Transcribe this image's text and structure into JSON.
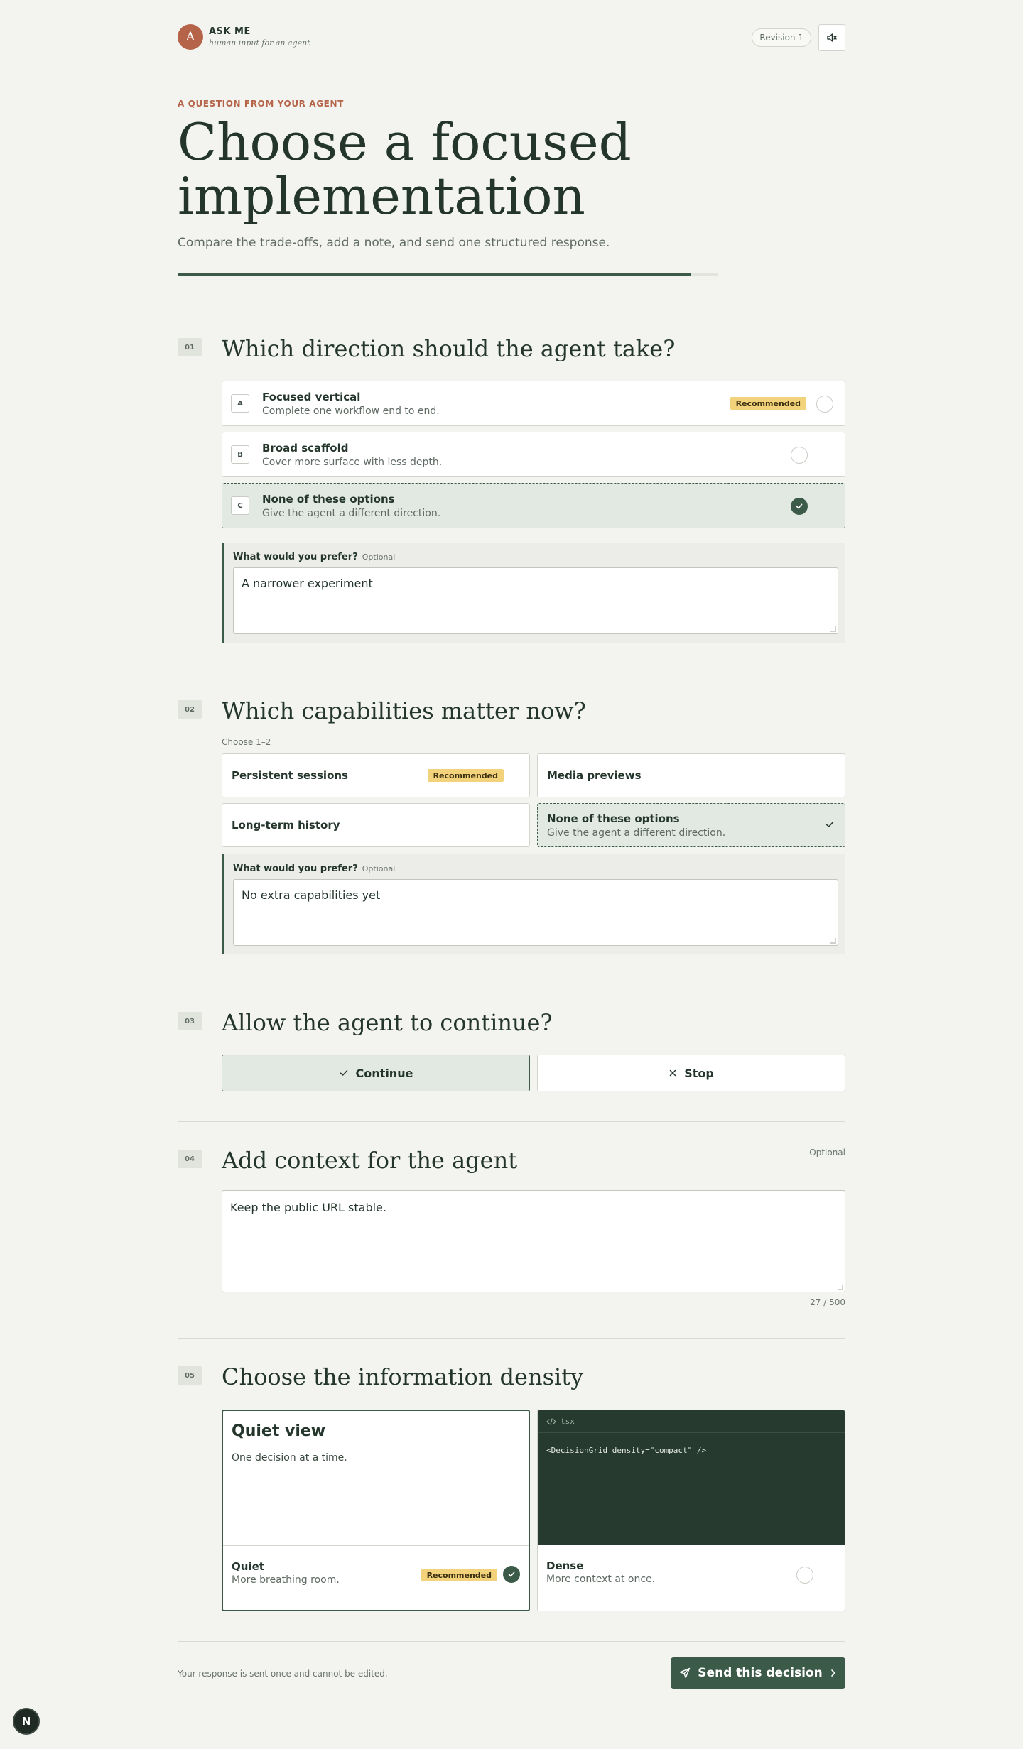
{
  "header": {
    "avatar_letter": "A",
    "brand_name": "ASK ME",
    "brand_subtitle": "human input for an agent",
    "revision": "Revision 1",
    "mute_icon": "speaker-mute-icon"
  },
  "hero": {
    "eyebrow": "A QUESTION FROM YOUR AGENT",
    "title": "Choose a focused implementation",
    "subtitle": "Compare the trade-offs, add a note, and send one structured response.",
    "progress_fraction": 0.95
  },
  "q1": {
    "number": "01",
    "title": "Which direction should the agent take?",
    "options": [
      {
        "key": "A",
        "label": "Focused vertical",
        "desc": "Complete one workflow end to end.",
        "badge": "Recommended",
        "selected": false
      },
      {
        "key": "B",
        "label": "Broad scaffold",
        "desc": "Cover more surface with less depth.",
        "selected": false
      },
      {
        "key": "C",
        "label": "None of these options",
        "desc": "Give the agent a different direction.",
        "selected": true
      }
    ],
    "note_label": "What would you prefer?",
    "note_optional": "Optional",
    "note_value": "A narrower experiment"
  },
  "q2": {
    "number": "02",
    "title": "Which capabilities matter now?",
    "hint": "Choose 1–2",
    "options": [
      {
        "label": "Persistent sessions",
        "badge": "Recommended",
        "selected": false
      },
      {
        "label": "Media previews",
        "selected": false
      },
      {
        "label": "Long-term history",
        "selected": false
      },
      {
        "label": "None of these options",
        "desc": "Give the agent a different direction.",
        "selected": true
      }
    ],
    "note_label": "What would you prefer?",
    "note_optional": "Optional",
    "note_value": "No extra capabilities yet"
  },
  "q3": {
    "number": "03",
    "title": "Allow the agent to continue?",
    "continue_label": "Continue",
    "stop_label": "Stop",
    "selected": "continue"
  },
  "q4": {
    "number": "04",
    "title": "Add context for the agent",
    "optional": "Optional",
    "value": "Keep the public URL stable.",
    "counter": "27 / 500"
  },
  "q5": {
    "number": "05",
    "title": "Choose the information density",
    "quiet": {
      "preview_title": "Quiet view",
      "preview_text": "One decision at a time.",
      "name": "Quiet",
      "desc": "More breathing room.",
      "badge": "Recommended",
      "selected": true
    },
    "dense": {
      "code_lang": "tsx",
      "code": "<DecisionGrid density=\"compact\" />",
      "name": "Dense",
      "desc": "More context at once.",
      "selected": false
    }
  },
  "footer": {
    "note": "Your response is sent once and cannot be edited.",
    "send_label": "Send this decision"
  },
  "fab_letter": "N",
  "colors": {
    "background": "#f3f4ef",
    "accent": "#3b5b48",
    "brand": "#b5644a",
    "badge": "#f2d27a"
  }
}
